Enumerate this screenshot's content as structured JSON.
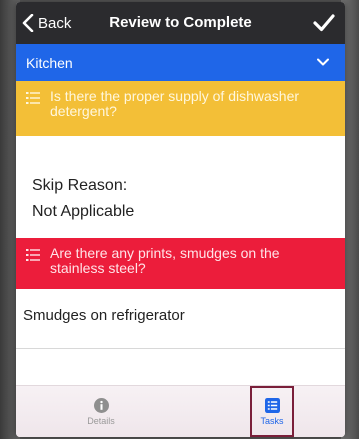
{
  "navbar": {
    "back_label": "Back",
    "title": "Review to Complete",
    "done_icon": "checkmark-icon"
  },
  "section": {
    "label": "Kitchen",
    "expanded_icon": "chevron-down-icon"
  },
  "tasks": [
    {
      "question": "Is there the proper supply of dishwasher detergent?",
      "status_color": "#f3bf37",
      "skip_reason_label": "Skip Reason:",
      "skip_reason_value": "Not Applicable"
    },
    {
      "question": "Are there any prints, smudges on the stainless steel?",
      "status_color": "#ec1d3b",
      "answer": "Smudges on refrigerator"
    }
  ],
  "tabbar": {
    "details_label": "Details",
    "tasks_label": "Tasks",
    "active_tab": "Tasks"
  },
  "colors": {
    "navbar": "#2b2b2e",
    "accent": "#1f66e8",
    "warning": "#f3bf37",
    "danger": "#ec1d3b"
  }
}
